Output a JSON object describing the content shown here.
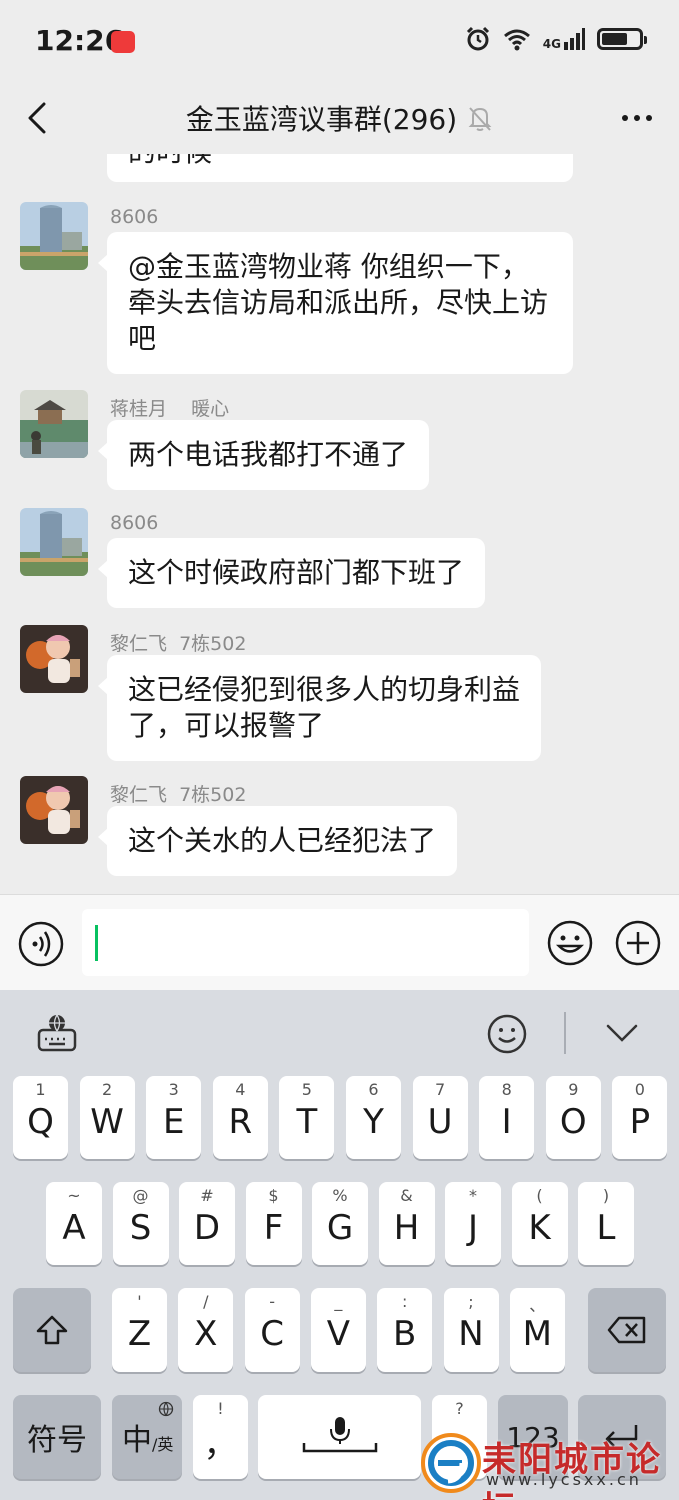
{
  "status_bar": {
    "time": "12:26",
    "network": "4G",
    "battery_level": 0.7
  },
  "header": {
    "title": "金玉蓝湾议事群(296)"
  },
  "messages": [
    {
      "sender": "8606",
      "text_lines": [
        "@金玉蓝湾物业蒋  你组织一下，",
        "牵头去信访局和派出所，尽快上访",
        "吧"
      ]
    },
    {
      "sender": "蒋桂月    暖心",
      "text_lines": [
        "两个电话我都打不通了"
      ]
    },
    {
      "sender": "8606",
      "text_lines": [
        "这个时候政府部门都下班了"
      ]
    },
    {
      "sender": "黎仁飞  7栋502",
      "text_lines": [
        "这已经侵犯到很多人的切身利益",
        "了，可以报警了"
      ]
    },
    {
      "sender": "黎仁飞  7栋502",
      "text_lines": [
        "这个关水的人已经犯法了"
      ]
    }
  ],
  "partial_message": {
    "text": "的时候"
  },
  "input": {
    "value": ""
  },
  "keyboard": {
    "row1": [
      {
        "hint": "1",
        "main": "Q"
      },
      {
        "hint": "2",
        "main": "W"
      },
      {
        "hint": "3",
        "main": "E"
      },
      {
        "hint": "4",
        "main": "R"
      },
      {
        "hint": "5",
        "main": "T"
      },
      {
        "hint": "6",
        "main": "Y"
      },
      {
        "hint": "7",
        "main": "U"
      },
      {
        "hint": "8",
        "main": "I"
      },
      {
        "hint": "9",
        "main": "O"
      },
      {
        "hint": "0",
        "main": "P"
      }
    ],
    "row2": [
      {
        "hint": "~",
        "main": "A"
      },
      {
        "hint": "@",
        "main": "S"
      },
      {
        "hint": "#",
        "main": "D"
      },
      {
        "hint": "$",
        "main": "F"
      },
      {
        "hint": "%",
        "main": "G"
      },
      {
        "hint": "&",
        "main": "H"
      },
      {
        "hint": "*",
        "main": "J"
      },
      {
        "hint": "(",
        "main": "K"
      },
      {
        "hint": ")",
        "main": "L"
      }
    ],
    "row3": [
      {
        "hint": "'",
        "main": "Z"
      },
      {
        "hint": "/",
        "main": "X"
      },
      {
        "hint": "-",
        "main": "C"
      },
      {
        "hint": "_",
        "main": "V"
      },
      {
        "hint": ":",
        "main": "B"
      },
      {
        "hint": ";",
        "main": "N"
      },
      {
        "hint": "、",
        "main": "M"
      }
    ],
    "symbols_label": "符号",
    "lang_main": "中",
    "lang_sub": "/英",
    "comma_hint": "!",
    "comma_main": "，",
    "period_hint": "?",
    "num_label": "123"
  },
  "watermark": {
    "text": "耒阳城市论坛",
    "url": "www.lycsxx.cn"
  }
}
